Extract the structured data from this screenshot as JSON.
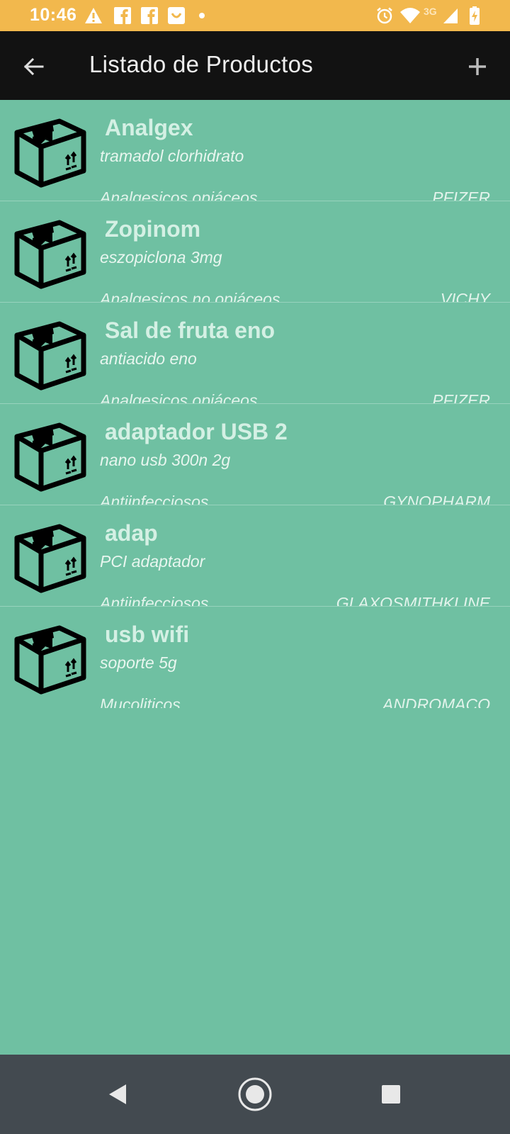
{
  "status_bar": {
    "time": "10:46",
    "network": "3G",
    "icons": [
      "warning-icon",
      "facebook-icon",
      "facebook-icon",
      "smile-app-icon",
      "dot-icon",
      "alarm-icon",
      "wifi-icon",
      "signal-icon",
      "battery-charging-icon"
    ],
    "color": "#f2b84d"
  },
  "app_bar": {
    "title": "Listado de Productos",
    "back_icon": "arrow-left-icon",
    "add_icon": "plus-icon",
    "color": "#121212"
  },
  "products": [
    {
      "name": "Analgex",
      "description": "tramadol clorhidrato",
      "category": "Analgesicos opiáceos",
      "lab": "PFIZER"
    },
    {
      "name": "Zopinom",
      "description": "eszopiclona 3mg",
      "category": "Analgesicos no opiáceos",
      "lab": "VICHY"
    },
    {
      "name": "Sal de fruta eno",
      "description": "antiacido eno",
      "category": "Analgesicos opiáceos",
      "lab": "PFIZER"
    },
    {
      "name": "adaptador USB 2",
      "description": "nano usb 300n 2g",
      "category": "Antiinfecciosos",
      "lab": "GYNOPHARM"
    },
    {
      "name": "adap",
      "description": "PCI adaptador",
      "category": "Antiinfecciosos",
      "lab": "GLAXOSMITHKLINE"
    },
    {
      "name": "usb wifi",
      "description": "soporte 5g",
      "category": "Mucoliticos",
      "lab": "ANDROMACO"
    }
  ],
  "list_background": "#6fc0a2",
  "nav_bar": {
    "buttons": [
      "back-triangle-icon",
      "home-circle-icon",
      "recents-square-icon"
    ],
    "color": "#434a50"
  }
}
